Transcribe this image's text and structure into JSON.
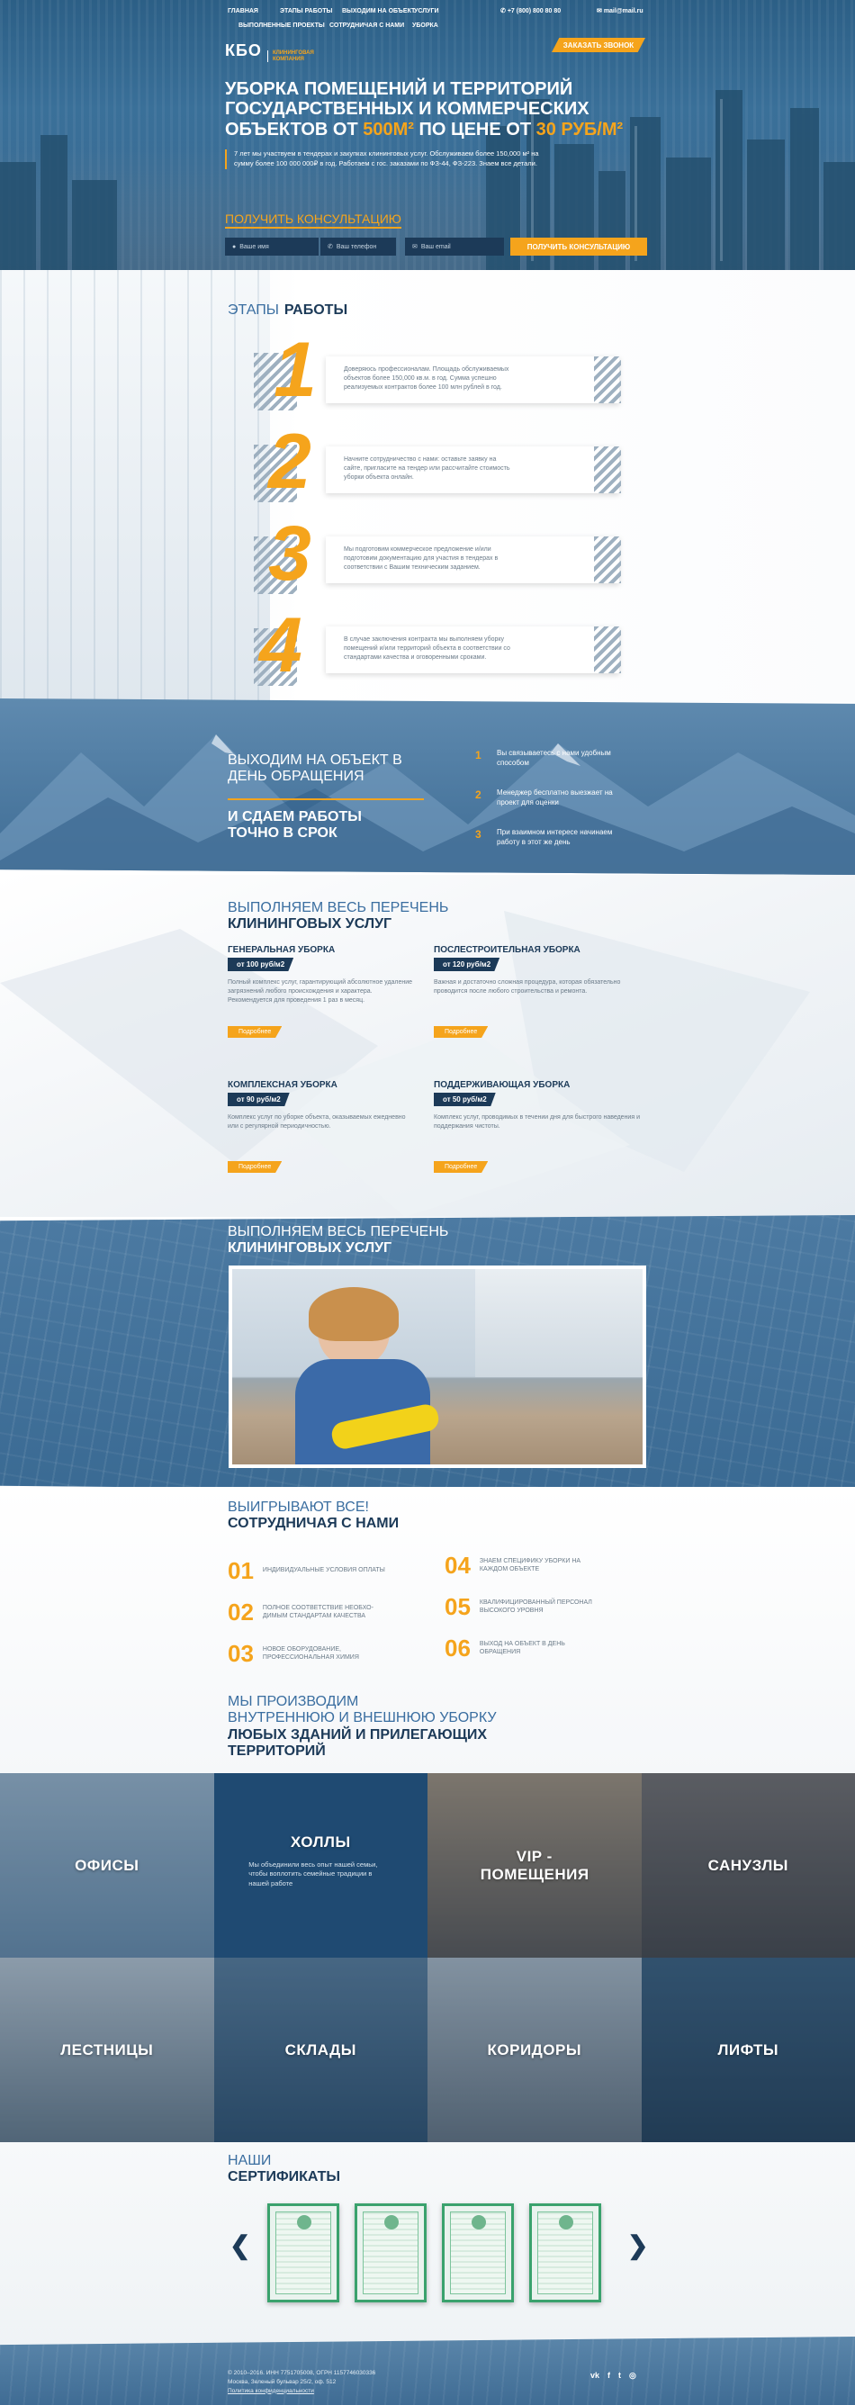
{
  "nav": {
    "items": [
      "Главная",
      "Этапы работы",
      "Выходим на объект",
      "Услуги",
      "Выполненные проекты",
      "Сотрудничая с нами",
      "Уборка"
    ],
    "phone": "+7 (800) 800 80 80",
    "email": "mail@mail.ru"
  },
  "logo": {
    "mark": "КБО",
    "subtitle": "Клининговая компания"
  },
  "callback_label": "Заказать звонок",
  "hero": {
    "title_line1": "Уборка помещений и территорий",
    "title_line2": "государственных и коммерческих",
    "title_line3_a": "объектов от ",
    "title_area": "500м²",
    "title_line3_b": " по цене от ",
    "title_price": "30 руб/м²",
    "lead": "7 лет мы участвуем в тендерах и закупках клининговых услуг. Обслуживаем более 150,000 м² на сумму более 100 000 000₽ в год. Работаем с гос. заказами по ФЗ-44, ФЗ-223. Знаем все детали.",
    "consult_title": "Получить консультацию",
    "form": {
      "name_placeholder": "Ваше имя",
      "phone_placeholder": "Ваш телефон",
      "email_placeholder": "Ваш email",
      "submit": "Получить консультацию"
    }
  },
  "steps": {
    "title_light": "Этапы",
    "title_bold": "работы",
    "items": [
      {
        "num": "1",
        "text": "Доверяюсь профессионалам. Площадь обслуживаемых объектов более 150,000 кв.м. в год. Сумма успешно реализуемых контрактов более 100 млн рублей в год."
      },
      {
        "num": "2",
        "text": "Начните сотрудничество с нами: оставьте заявку на сайте, пригласите на тендер или рассчитайте стоимость уборки объекта онлайн."
      },
      {
        "num": "3",
        "text": "Мы подготовим коммерческое предложение и/или подготовим документацию для участия в тендерах в соответствии с Вашим техническим заданием."
      },
      {
        "num": "4",
        "text": "В случае заключения контракта мы выполняем уборку помещений и/или территорий объекта в соответствии со стандартами качества и оговоренными сроками."
      }
    ]
  },
  "visit": {
    "title_light_1": "Выходим на объект в",
    "title_light_2": "день обращения",
    "title_bold_1": "И сдаем работы",
    "title_bold_2": "точно в срок",
    "items": [
      {
        "num": "1",
        "text": "Вы связываетесь с нами удобным способом"
      },
      {
        "num": "2",
        "text": "Менеджер бесплатно выезжает на проект для оценки"
      },
      {
        "num": "3",
        "text": "При взаимном интересе начинаем работу в этот же день"
      }
    ]
  },
  "services": {
    "title_light": "Выполняем весь перечень",
    "title_bold": "клининговых услуг",
    "items": [
      {
        "title": "Генеральная уборка",
        "price": "от 100 руб/м2",
        "text": "Полный комплекс услуг, гарантирующий абсолютное удаление загрязнений любого происхождения и характера. Рекомендуется для проведения 1 раз в месяц.",
        "btn": "Подробнее"
      },
      {
        "title": "Послестроительная уборка",
        "price": "от 120 руб/м2",
        "text": "Важная и достаточно сложная процедура, которая обязательно проводится после любого строительства и ремонта.",
        "btn": "Подробнее"
      },
      {
        "title": "Комплексная уборка",
        "price": "от 90 руб/м2",
        "text": "Комплекс услуг по уборке объекта, оказываемых ежедневно или с регулярной периодичностью.",
        "btn": "Подробнее"
      },
      {
        "title": "Поддерживающая уборка",
        "price": "от 50 руб/м2",
        "text": "Комплекс услуг, проводимых в течении дня для быстрого наведения и поддержания чистоты.",
        "btn": "Подробнее"
      }
    ]
  },
  "video": {
    "title_light": "Выполняем весь перечень",
    "title_bold": "клининговых услуг"
  },
  "benefits": {
    "title_light": "Выигрывают все!",
    "title_bold": "Сотрудничая с нами",
    "items": [
      {
        "num": "01",
        "text": "Индивидуальные условия оплаты"
      },
      {
        "num": "02",
        "text": "Полное соответствие необхо-димым стандартам качества"
      },
      {
        "num": "03",
        "text": "Новое оборудование, профессиональная химия"
      },
      {
        "num": "04",
        "text": "Знаем специфику уборки на каждом объекте"
      },
      {
        "num": "05",
        "text": "Квалифицированный персонал высокого уровня"
      },
      {
        "num": "06",
        "text": "Выход на объект в день обращения"
      }
    ]
  },
  "objects": {
    "title_light_1": "Мы производим",
    "title_light_2": "внутреннюю и внешнюю уборку",
    "title_bold_1": "любых зданий и прилегающих",
    "title_bold_2": "территорий",
    "tiles": [
      "Офисы",
      "Холлы",
      "VIP - помещения",
      "Санузлы",
      "Лестницы",
      "Склады",
      "Коридоры",
      "Лифты"
    ],
    "halls_text": "Мы объединили весь опыт нашей семьи, чтобы воплотить семейные традиции в нашей работе"
  },
  "certs": {
    "title_light": "Наши",
    "title_bold": "Сертификаты",
    "prev": "❮",
    "next": "❯"
  },
  "footer": {
    "copy": "© 2010–2016. ИНН 7751705008, ОГРН 1157746030336",
    "address": "Москва, Зеленый бульвар 25/2, оф. 512",
    "privacy": "Политика конфиденциальности",
    "social": [
      "vk",
      "facebook",
      "twitter",
      "instagram"
    ]
  },
  "colors": {
    "accent": "#f5a41c",
    "navy": "#1c3a58",
    "blue": "#3a6ea0"
  }
}
